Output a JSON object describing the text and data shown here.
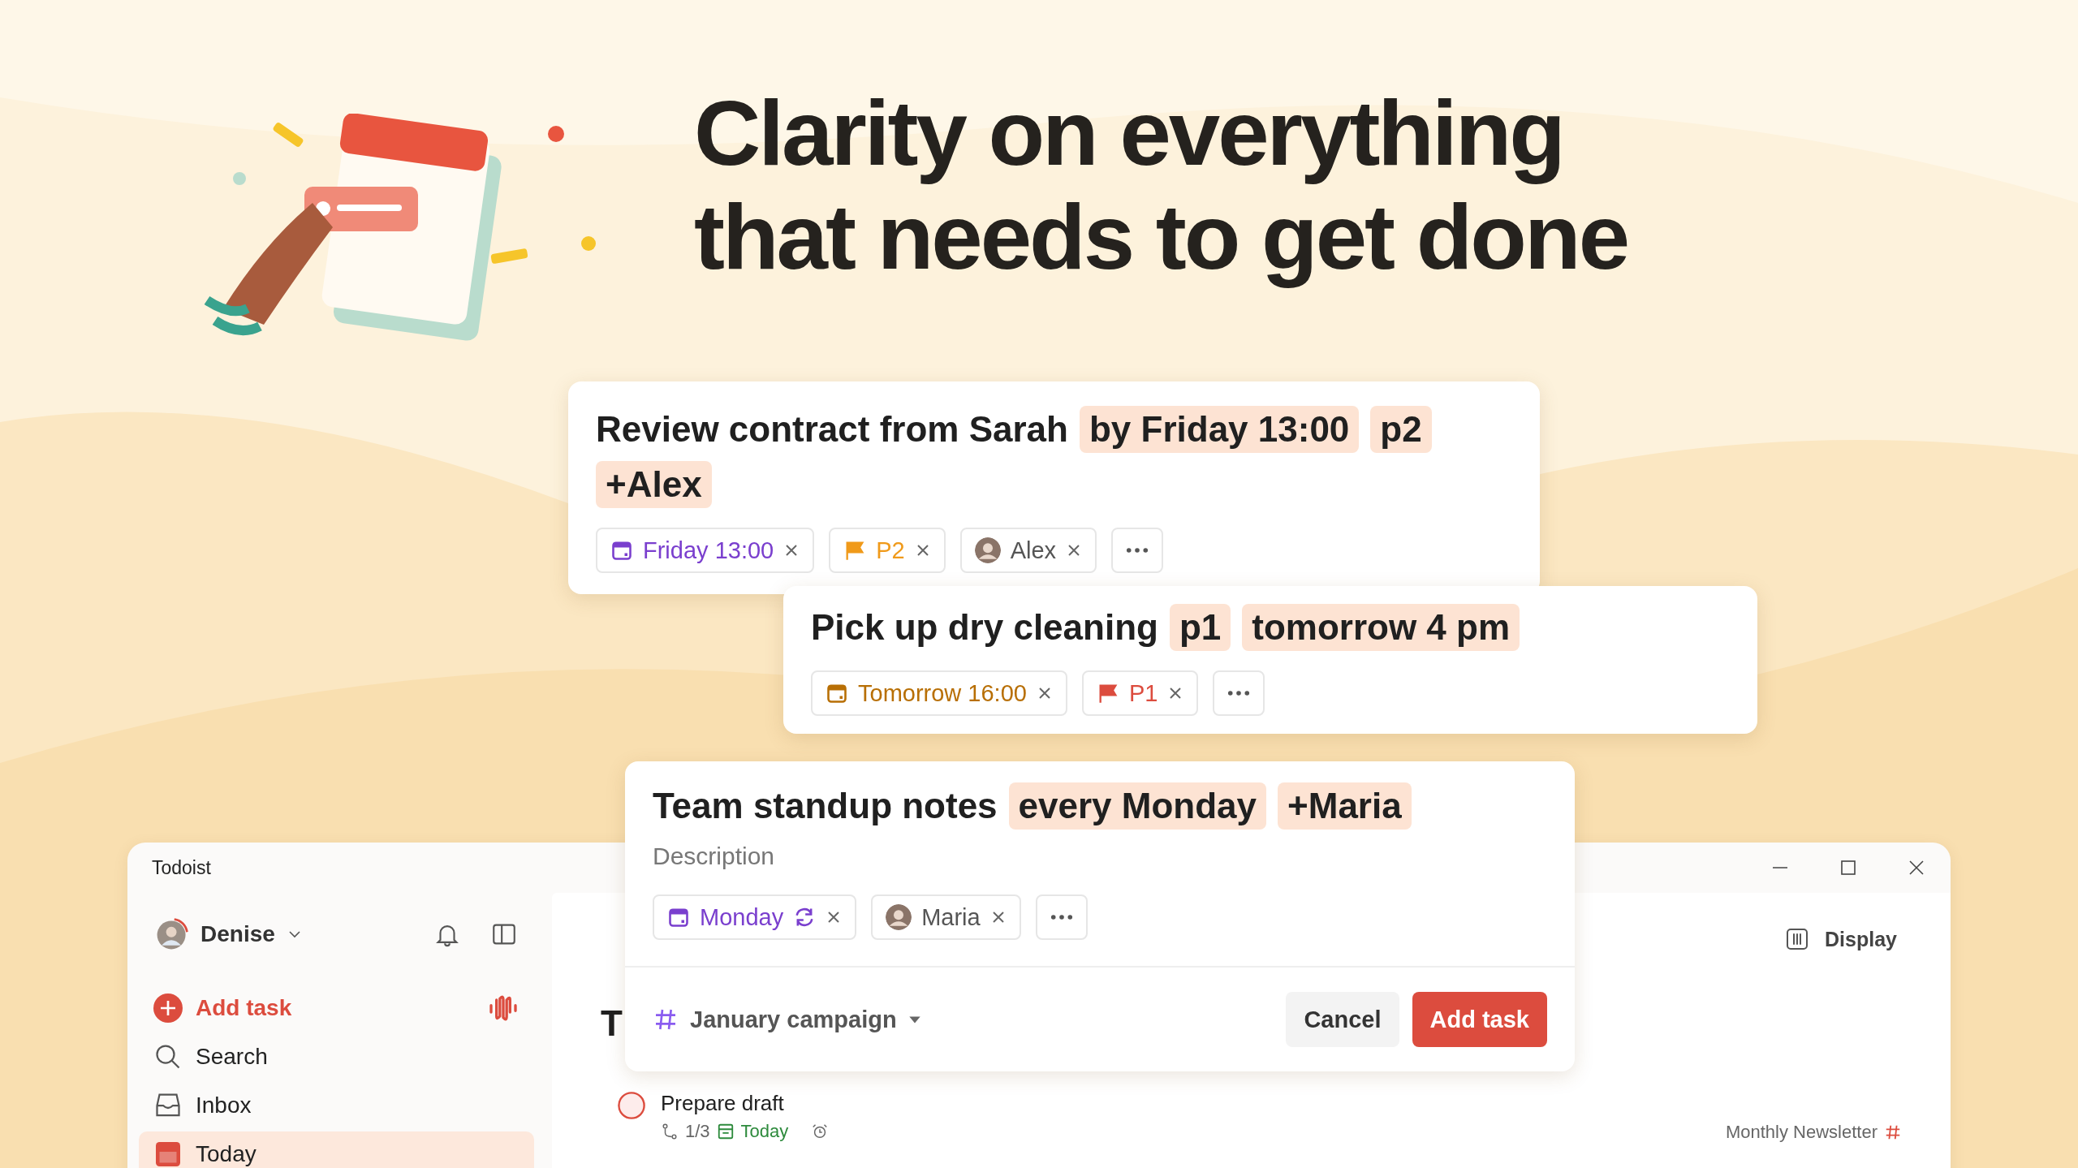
{
  "headline": [
    "Clarity on everything",
    "that needs to get done"
  ],
  "task_cards": [
    {
      "title": "Review contract from Sarah",
      "tokens": [
        "by Friday 13:00",
        "p2",
        "+Alex"
      ],
      "chips": [
        {
          "kind": "date",
          "label": "Friday 13:00",
          "color": "#7a3fce",
          "repeat": false
        },
        {
          "kind": "priority",
          "label": "P2",
          "color": "#f09a1a"
        },
        {
          "kind": "person",
          "label": "Alex"
        }
      ]
    },
    {
      "title": "Pick up dry cleaning",
      "tokens": [
        "p1",
        "tomorrow 4 pm"
      ],
      "chips": [
        {
          "kind": "date",
          "label": "Tomorrow 16:00",
          "color": "#b86f05",
          "repeat": false
        },
        {
          "kind": "priority",
          "label": "P1",
          "color": "#dc4c3e"
        }
      ]
    },
    {
      "title": "Team standup notes",
      "tokens": [
        "every Monday",
        "+Maria"
      ],
      "description_placeholder": "Description",
      "chips": [
        {
          "kind": "date",
          "label": "Monday",
          "color": "#7a3fce",
          "repeat": true
        },
        {
          "kind": "person",
          "label": "Maria"
        }
      ],
      "project": "January campaign",
      "buttons": [
        {
          "kind": "secondary",
          "label": "Cancel"
        },
        {
          "kind": "primary",
          "label": "Add task"
        }
      ]
    }
  ],
  "window": {
    "title": "Todoist"
  },
  "sidebar": {
    "user": "Denise",
    "items": [
      {
        "kind": "add",
        "label": "Add task",
        "selected": false
      },
      {
        "kind": "search",
        "label": "Search",
        "selected": false
      },
      {
        "kind": "inbox",
        "label": "Inbox",
        "selected": false
      },
      {
        "kind": "today",
        "label": "Today",
        "selected": true
      }
    ]
  },
  "main": {
    "heading": "T",
    "display_button": "Display",
    "tasks": [
      {
        "checked": false,
        "title": "Prepare draft",
        "subtasks": "1/3",
        "due": "Today",
        "project": "Monthly Newsletter"
      }
    ]
  }
}
